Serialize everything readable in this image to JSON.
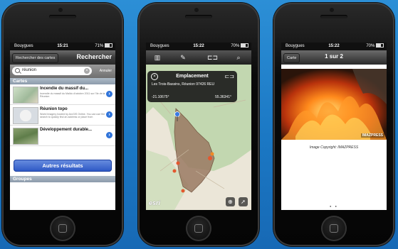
{
  "phone1": {
    "status": {
      "carrier": "Bouygues",
      "time": "15:21",
      "battery": "71%"
    },
    "nav": {
      "back_label": "Rechercher des cartes",
      "title": "Rechercher"
    },
    "search": {
      "value": "réunion",
      "cancel_label": "Annuler"
    },
    "section_cartes": "Cartes",
    "results": [
      {
        "title": "Incendie du massif du...",
        "desc": "Incendie du massif du Maïdo d'octobre 2011 sur l'île de la Réunion"
      },
      {
        "title": "Réunion topo",
        "desc": "World Imagery hosted by ArcGIS Online. You can use the search to quickly find an address or place from"
      },
      {
        "title": "Développement durable...",
        "desc": ""
      }
    ],
    "more_label": "Autres résultats",
    "section_groupes": "Groupes"
  },
  "phone2": {
    "status": {
      "carrier": "Bouygues",
      "time": "15:22",
      "battery": "70%"
    },
    "callout": {
      "title": "Emplacement",
      "address": "Les Trois-Bassins, Réunion 97426 REU",
      "lat": "-21.10675°",
      "lon": "55.36341°"
    },
    "logo": "esri"
  },
  "phone3": {
    "status": {
      "carrier": "Bouygues",
      "time": "15:22",
      "battery": "70%"
    },
    "nav": {
      "back_label": "Carte",
      "title": "1 sur 2"
    },
    "photo_watermark": "IMAZPRESS",
    "caption": "Image Copyright: IMAZPRESS",
    "pager": "● ●"
  },
  "colors": {
    "background": "#1b78c4",
    "accent": "#2f73d9"
  }
}
